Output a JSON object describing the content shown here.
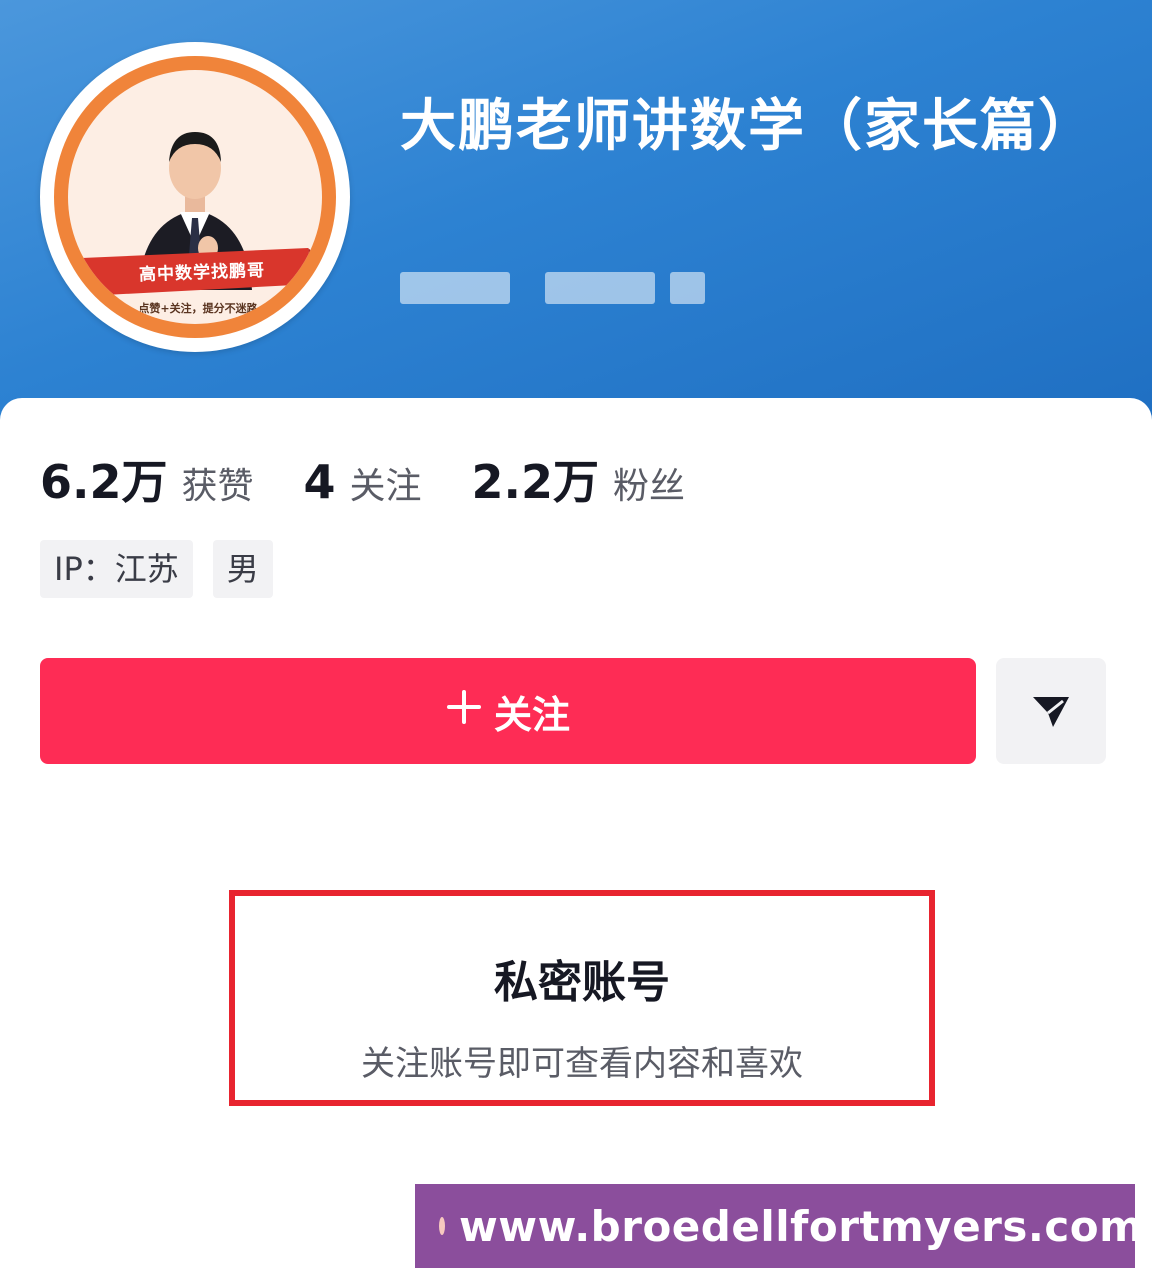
{
  "profile": {
    "name": "大鹏老师讲数学（家长篇）",
    "avatar_banner_text": "高中数学找鹏哥",
    "avatar_caption_text": "点赞+关注，提分不迷路"
  },
  "stats": [
    {
      "value": "6.2万",
      "label": "获赞"
    },
    {
      "value": "4",
      "label": "关注"
    },
    {
      "value": "2.2万",
      "label": "粉丝"
    }
  ],
  "tags": [
    "IP：江苏",
    "男"
  ],
  "actions": {
    "follow_label": "关注",
    "follow_icon": "plus-icon",
    "share_icon": "send-icon"
  },
  "private_notice": {
    "title": "私密账号",
    "subtitle": "关注账号即可查看内容和喜欢"
  },
  "watermark": {
    "text": "www.broedellfortmyers.com"
  },
  "colors": {
    "header_blue": "#2d82d2",
    "follow_red": "#fe2c55",
    "highlight_red": "#e8242f",
    "watermark_purple": "#8b4e9c"
  }
}
